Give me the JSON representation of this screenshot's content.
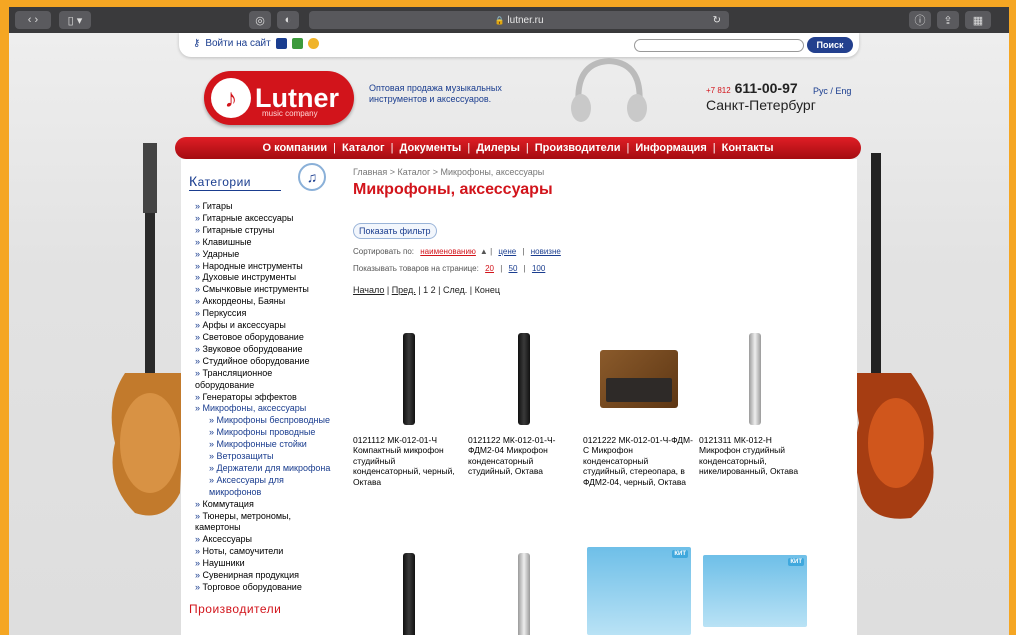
{
  "browser": {
    "url": "lutner.ru"
  },
  "topbar": {
    "login": "Войти на сайт",
    "search_button": "Поиск"
  },
  "header": {
    "logo_text": "Lutner",
    "logo_sub": "music company",
    "tagline": "Оптовая продажа музыкальных инструментов и аксессуаров.",
    "phone_prefix": "+7 812",
    "phone_number": "611-00-97",
    "city": "Санкт-Петербург",
    "lang_ru": "Рус",
    "lang_sep": " / ",
    "lang_en": "Eng"
  },
  "nav": [
    "О компании",
    "Каталог",
    "Документы",
    "Дилеры",
    "Производители",
    "Информация",
    "Контакты"
  ],
  "sidebar": {
    "categories_title": "Категории",
    "categories": [
      "Гитары",
      "Гитарные аксессуары",
      "Гитарные струны",
      "Клавишные",
      "Ударные",
      "Народные инструменты",
      "Духовые инструменты",
      "Смычковые инструменты",
      "Аккордеоны, Баяны",
      "Перкуссия",
      "Арфы и аксессуары",
      "Световое оборудование",
      "Звуковое оборудование",
      "Студийное оборудование",
      "Трансляционное оборудование",
      "Генераторы эффектов",
      "Микрофоны, аксессуары"
    ],
    "subcategories": [
      "Микрофоны беспроводные",
      "Микрофоны проводные",
      "Микрофонные стойки",
      "Ветрозащиты",
      "Держатели для микрофона",
      "Аксессуары для микрофонов"
    ],
    "categories_after": [
      "Коммутация",
      "Тюнеры, метрономы, камертоны",
      "Аксессуары",
      "Ноты, самоучители",
      "Наушники",
      "Сувенирная продукция",
      "Торговое оборудование"
    ],
    "producers_title": "Производители"
  },
  "main": {
    "breadcrumb": "Главная > Каталог > Микрофоны, аксессуары",
    "title": "Микрофоны, аксессуары",
    "filter_button": "Показать фильтр",
    "sort_label": "Сортировать по:",
    "sort_options": [
      "наименованию",
      "цене",
      "новизне"
    ],
    "per_page_label": "Показывать товаров на странице:",
    "per_page_options": [
      "20",
      "50",
      "100"
    ],
    "pager": {
      "first": "Начало",
      "prev": "Пред.",
      "pages": "1 2",
      "next": "След.",
      "last": "Конец"
    },
    "products": [
      {
        "desc": "0121112 МК-012-01-Ч Компактный микрофон студийный конденсаторный, черный, Октава"
      },
      {
        "desc": "0121122 МК-012-01-Ч-ФДМ2-04 Микрофон конденсаторный студийный, Октава"
      },
      {
        "desc": "0121222 МК-012-01-Ч-ФДМ-С Микрофон конденсаторный студийный, стереопара, в ФДМ2-04, черный, Октава"
      },
      {
        "desc": "0121311 МК-012-Н Микрофон студийный конденсаторный, никелированный, Октава"
      }
    ],
    "kit_badge": "КИТ"
  },
  "colors": {
    "brand_red": "#d2141b",
    "brand_blue": "#1a3d8f",
    "frame_orange": "#f5a623"
  }
}
